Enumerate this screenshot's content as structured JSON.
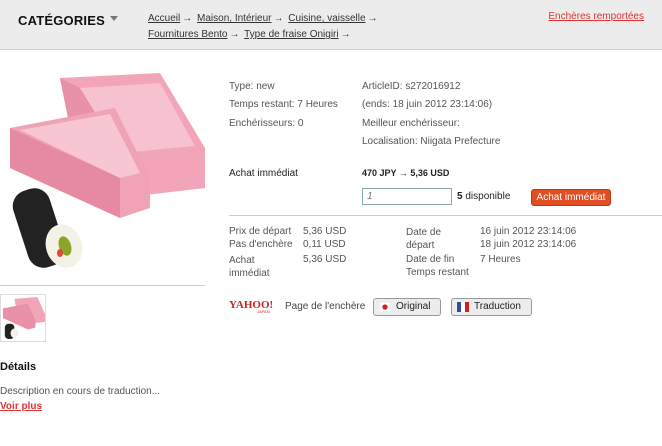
{
  "header": {
    "categories_label": "CATÉGORIES",
    "breadcrumb": [
      "Accueil",
      "Maison, Intérieur",
      "Cuisine, vaisselle",
      "Fournitures Bento",
      "Type de fraise Onigiri"
    ],
    "separator": "→",
    "history_link": "Enchères remportées"
  },
  "item": {
    "type": "Type: new",
    "article_id": "ArticleID: s272016912",
    "time_left": "Temps restant: 7 Heures",
    "ends": "(ends: 18 juin 2012 23:14:06)",
    "bidders": "Enchérisseurs: 0",
    "best_bidder": "Meilleur enchérisseur:",
    "location": "Localisation: Niigata Prefecture"
  },
  "buy": {
    "label": "Achat immédiat",
    "price": "470 JPY → 5,36 USD",
    "quantity_placeholder": "1",
    "available_count": "5",
    "available_text": "disponible",
    "button": "Achat immédiat"
  },
  "prices": [
    {
      "label": "Prix de départ",
      "value": "5,36 USD"
    },
    {
      "label": "Pas d'enchère",
      "value": "0,11 USD"
    },
    {
      "label": "Achat immédiat",
      "value": "5,36 USD"
    }
  ],
  "dates": [
    {
      "label": "Date de départ",
      "value": "16 juin 2012 23:14:06"
    },
    {
      "label": "Date de fin",
      "value": "18 juin 2012 23:14:06"
    },
    {
      "label": "Temps restant",
      "value": "7 Heures"
    }
  ],
  "source": {
    "logo_text": "YAHOO!",
    "logo_sub": "JAPAN",
    "label": "Page de l'enchère",
    "original_btn": "Original",
    "translate_btn": "Traduction"
  },
  "details": {
    "title": "Détails",
    "text": "Description en cours de traduction...",
    "more": "Voir plus"
  },
  "colors": {
    "accent": "#e04e22",
    "link_red": "#dd3333",
    "product_pink": "#f2a5b8"
  }
}
